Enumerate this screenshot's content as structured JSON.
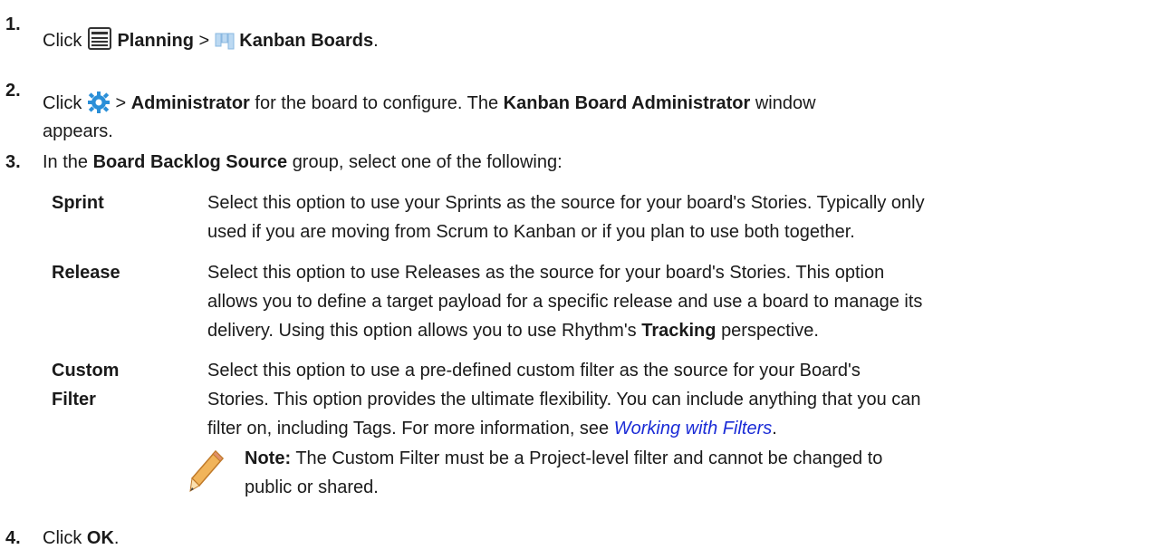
{
  "steps": [
    {
      "number": "1.",
      "parts": [
        "Click",
        "Planning",
        ">",
        "Kanban Boards",
        "."
      ],
      "icons": [
        "planning-icon",
        "kanban-boards-icon"
      ]
    },
    {
      "number": "2.",
      "parts": [
        "Click",
        ">",
        "Administrator",
        "for the board to configure. The",
        "Kanban Board Administrator",
        "window",
        "appears."
      ],
      "icons": [
        "gear-icon"
      ]
    },
    {
      "number": "3.",
      "parts": [
        "In the",
        "Board Backlog Source",
        "group, select one of the following:"
      ]
    },
    {
      "number": "4.",
      "parts": [
        "Click",
        "OK",
        "."
      ]
    }
  ],
  "options": [
    {
      "term": "Sprint",
      "lines": [
        "Select this option to use your Sprints as the source for your board's Stories. Typically only",
        "used if you are moving from Scrum to Kanban or if you plan to use both together."
      ]
    },
    {
      "term": "Release",
      "lines": [
        "Select this option to use Releases as the source for your board's Stories. This option",
        "allows you to define a target payload for a specific release and use a board to manage its"
      ],
      "line3_pre": "delivery. Using this option allows you to use Rhythm's",
      "line3_bold": "Tracking",
      "line3_post": "perspective."
    },
    {
      "term_line1": "Custom",
      "term_line2": "Filter",
      "lines": [
        "Select this option to use a pre-defined custom filter as the source for your Board's",
        "Stories. This option provides the ultimate flexibility. You can include anything that you can"
      ],
      "line3_pre": "filter on, including Tags. For more information, see",
      "link": "Working with Filters",
      "line3_post": "."
    }
  ],
  "note": {
    "label": "Note:",
    "line1": "The Custom Filter must be a Project-level filter and cannot be changed to",
    "line2": "public or shared.",
    "icon": "pencil-icon"
  },
  "colors": {
    "link": "#1a2bd6",
    "gear": "#2a8fd8",
    "pencil": "#e8a040"
  }
}
